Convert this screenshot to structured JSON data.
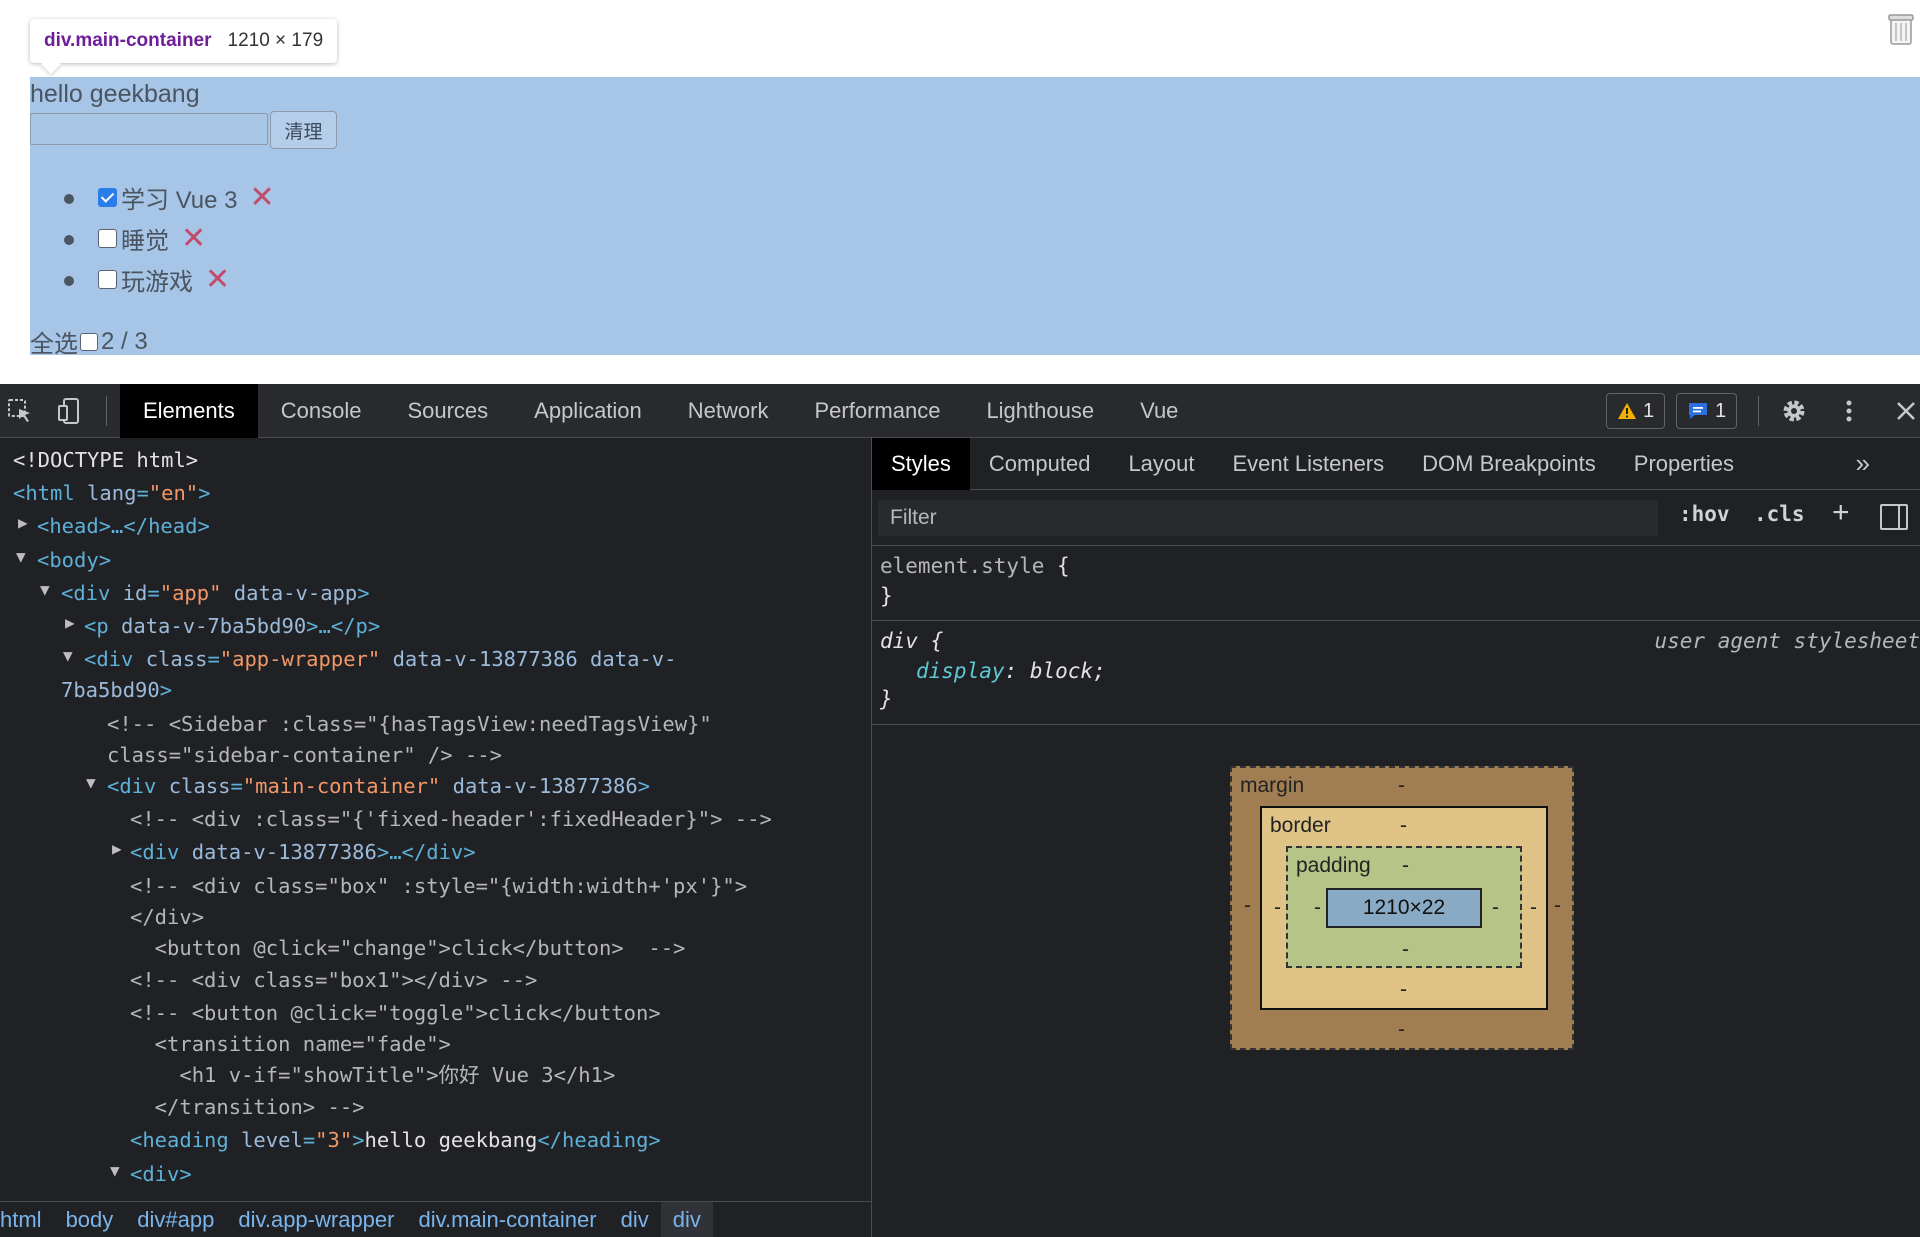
{
  "inspect_tooltip": {
    "element": "div.main-container",
    "size": "1210 × 179"
  },
  "page": {
    "heading": "hello geekbang",
    "input_value": "",
    "clear_button": "清理",
    "todos": [
      {
        "label": "学习 Vue 3",
        "done": true
      },
      {
        "label": "睡觉",
        "done": false
      },
      {
        "label": "玩游戏",
        "done": false
      }
    ],
    "delete_glyph": "✕",
    "select_all_label": "全选",
    "progress": "2 / 3"
  },
  "devtools": {
    "main_tabs": [
      "Elements",
      "Console",
      "Sources",
      "Application",
      "Network",
      "Performance",
      "Lighthouse",
      "Vue"
    ],
    "active_main_tab": "Elements",
    "warnings_count": "1",
    "messages_count": "1",
    "sub_tabs": [
      "Styles",
      "Computed",
      "Layout",
      "Event Listeners",
      "DOM Breakpoints",
      "Properties"
    ],
    "active_sub_tab": "Styles",
    "more_tabs_glyph": "»",
    "filter_placeholder": "Filter",
    "hov_label": ":hov",
    "cls_label": ".cls",
    "plus_label": "+",
    "rules": {
      "element_style_selector": "element.style",
      "open_brace": " {",
      "close_brace": "}",
      "div_selector": "div",
      "div_source": "user agent stylesheet",
      "div_property": "display",
      "div_value": "block;"
    },
    "box_model": {
      "margin_label": "margin",
      "border_label": "border",
      "padding_label": "padding",
      "content_size": "1210×22",
      "dash": "-"
    },
    "breadcrumbs": [
      "html",
      "body",
      "div#app",
      "div.app-wrapper",
      "div.main-container",
      "div",
      "div"
    ],
    "dom": {
      "doctype": "<!DOCTYPE html>",
      "html_open": "<html",
      "lang_attr": " lang",
      "lang_val": "\"en\"",
      "gt": ">",
      "head": "<head>…</head>",
      "body_open": "<body>",
      "div_app_open": "<div",
      "id_attr": " id",
      "id_val": "\"app\"",
      "data_v_app": " data-v-app",
      "p_line_tag": "<p",
      "p_line_attr": " data-v-7ba5bd90",
      "p_line_rest": ">…</p>",
      "wrapper_tag": "<div",
      "class_attr": " class",
      "wrapper_val": "\"app-wrapper\"",
      "wrapper_attr1": " data-v-13877386 data-v-",
      "wrapper_attr2": "7ba5bd90",
      "comment_sidebar_1": "<!-- <Sidebar :class=\"{hasTagsView:needTagsView}\"",
      "comment_sidebar_2": "class=\"sidebar-container\" /> -->",
      "main_tag": "<div",
      "main_val": "\"main-container\"",
      "main_attr": " data-v-13877386",
      "comment_fixed": "<!-- <div :class=\"{'fixed-header':fixedHeader}\"> -->",
      "child_div_tag": "<div",
      "child_div_attr": " data-v-13877386",
      "child_div_rest": ">…</div>",
      "comment_box_1": "<!-- <div class=\"box\" :style=\"{width:width+'px'}\">",
      "comment_box_2": "</div>",
      "comment_box_3": "  <button @click=\"change\">click</button>  -->",
      "comment_box1": "<!-- <div class=\"box1\"></div> -->",
      "comment_toggle_1": "<!-- <button @click=\"toggle\">click</button>",
      "comment_toggle_2": "  <transition name=\"fade\">",
      "comment_toggle_3": "    <h1 v-if=\"showTitle\">你好 Vue 3</h1>",
      "comment_toggle_4": "  </transition> -->",
      "heading_tag": "<heading",
      "level_attr": " level",
      "level_val": "\"3\"",
      "heading_text": "hello geekbang",
      "heading_close": "</heading>",
      "last_div": "<div>"
    }
  }
}
